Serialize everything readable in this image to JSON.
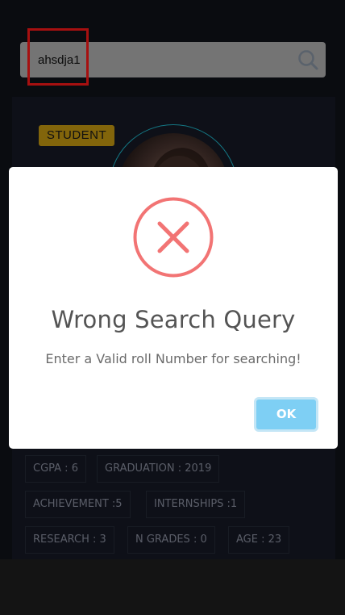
{
  "search": {
    "value": "ahsdja1",
    "icon": "search-icon"
  },
  "profile": {
    "badge": "STUDENT",
    "avatar": "avatar"
  },
  "stats": [
    "CGPA : 6",
    "GRADUATION : 2019",
    "ACHIEVEMENT :5",
    "INTERNSHIPS :1",
    "RESEARCH : 3",
    "N GRADES : 0",
    "AGE : 23"
  ],
  "modal": {
    "icon": "error-x-icon",
    "title": "Wrong Search Query",
    "message": "Enter a Valid roll Number for searching!",
    "ok_label": "OK"
  },
  "colors": {
    "background": "#10131a",
    "card": "#161a26",
    "badge": "#c89b12",
    "error": "#f27474",
    "ok_button": "#7ecff4",
    "highlight": "#ff1a1a"
  }
}
